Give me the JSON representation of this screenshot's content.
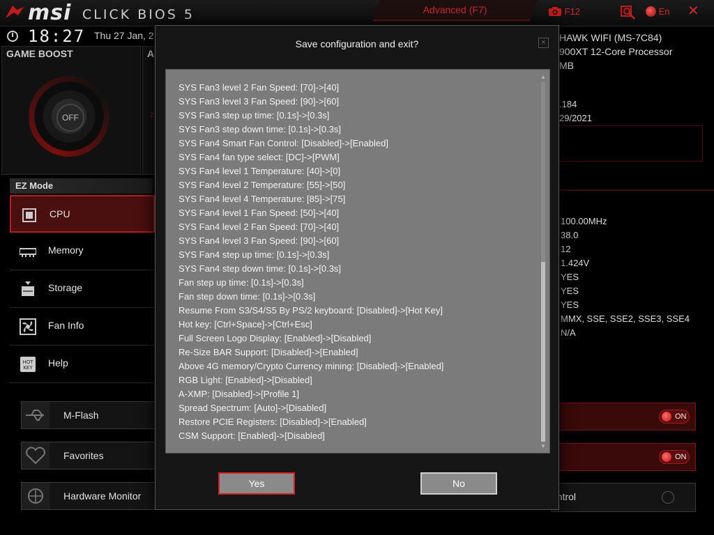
{
  "header": {
    "brand": "msi",
    "product": "CLICK BIOS 5",
    "mode_label": "Advanced (F7)",
    "screenshot_label": "F12",
    "language_label": "En"
  },
  "clock": {
    "time": "18:27",
    "date": "Thu  27 Jan, 2"
  },
  "game_boost": {
    "title": "GAME BOOST",
    "state": "OFF",
    "help": "?"
  },
  "axmp_panel": {
    "title": "A",
    "number": "2"
  },
  "ez_mode": {
    "title": "EZ Mode",
    "items": [
      {
        "label": "CPU",
        "icon": "cpu-icon"
      },
      {
        "label": "Memory",
        "icon": "memory-icon"
      },
      {
        "label": "Storage",
        "icon": "storage-icon"
      },
      {
        "label": "Fan Info",
        "icon": "fan-icon"
      },
      {
        "label": "Help",
        "icon": "hotkey-icon"
      }
    ]
  },
  "bottom_buttons": [
    {
      "label": "M-Flash",
      "icon": "usb-icon"
    },
    {
      "label": "Favorites",
      "icon": "heart-icon"
    },
    {
      "label": "Hardware Monitor",
      "icon": "monitor-icon"
    }
  ],
  "system_info": {
    "lines": [
      "HAWK WIFI (MS-7C84)",
      "900XT 12-Core Processor",
      "MB"
    ],
    "bios_lines": [
      ".184",
      "29/2021"
    ]
  },
  "cpu_values": [
    "100.00MHz",
    "38.0",
    "12",
    "1.424V",
    "YES",
    "YES",
    "YES",
    "MMX, SSE, SSE2, SSE3, SSE4",
    "N/A"
  ],
  "toggles": {
    "on_label": "ON"
  },
  "control_row": {
    "label": "ontrol"
  },
  "dialog": {
    "title": "Save configuration and exit?",
    "close": "×",
    "changes": [
      "SYS Fan3 level 2 Fan Speed: [70]->[40]",
      "SYS Fan3 level 3 Fan Speed: [90]->[60]",
      "SYS Fan3 step up time: [0.1s]->[0.3s]",
      "SYS Fan3 step down time: [0.1s]->[0.3s]",
      "SYS Fan4 Smart Fan Control: [Disabled]->[Enabled]",
      "SYS Fan4 fan type select: [DC]->[PWM]",
      "SYS Fan4 level 1 Temperature: [40]->[0]",
      "SYS Fan4 level 2 Temperature: [55]->[50]",
      "SYS Fan4 level 4 Temperature: [85]->[75]",
      "SYS Fan4 level 1 Fan Speed: [50]->[40]",
      "SYS Fan4 level 2 Fan Speed: [70]->[40]",
      "SYS Fan4 level 3 Fan Speed: [90]->[60]",
      "SYS Fan4 step up time: [0.1s]->[0.3s]",
      "SYS Fan4 step down time: [0.1s]->[0.3s]",
      "Fan step up time: [0.1s]->[0.3s]",
      "Fan step down time: [0.1s]->[0.3s]",
      "Resume From S3/S4/S5 By PS/2 keyboard: [Disabled]->[Hot Key]",
      "Hot key: [Ctrl+Space]->[Ctrl+Esc]",
      "Full Screen Logo Display: [Enabled]->[Disabled]",
      "Re-Size BAR Support: [Disabled]->[Enabled]",
      "Above 4G memory/Crypto Currency mining: [Disabled]->[Enabled]",
      "RGB Light: [Enabled]->[Disabled]",
      "A-XMP: [Disabled]->[Profile 1]",
      "Spread Spectrum: [Auto]->[Disabled]",
      "Restore PCIE Registers: [Disabled]->[Enabled]",
      "CSM Support: [Enabled]->[Disabled]"
    ],
    "yes_label": "Yes",
    "no_label": "No"
  },
  "colors": {
    "accent_red": "#d42020",
    "panel_grey": "#7b7b7b",
    "dark_bg": "#161616"
  }
}
